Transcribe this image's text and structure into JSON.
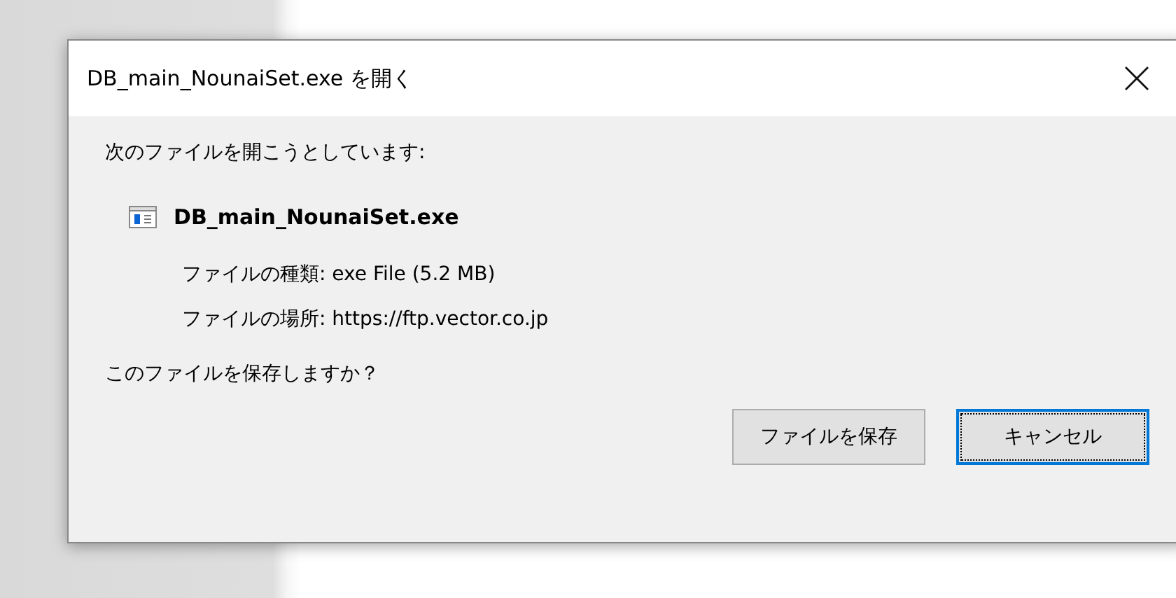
{
  "dialog": {
    "title": "DB_main_NounaiSet.exe を開く",
    "intro": "次のファイルを開こうとしています:",
    "file_name": "DB_main_NounaiSet.exe",
    "details": [
      {
        "label": "ファイルの種類:",
        "value": "exe File (5.2 MB)"
      },
      {
        "label": "ファイルの場所:",
        "value": "https://ftp.vector.co.jp"
      }
    ],
    "question": "このファイルを保存しますか？",
    "buttons": [
      {
        "label": "ファイルを保存",
        "focused": false
      },
      {
        "label": "キャンセル",
        "focused": true
      }
    ]
  }
}
